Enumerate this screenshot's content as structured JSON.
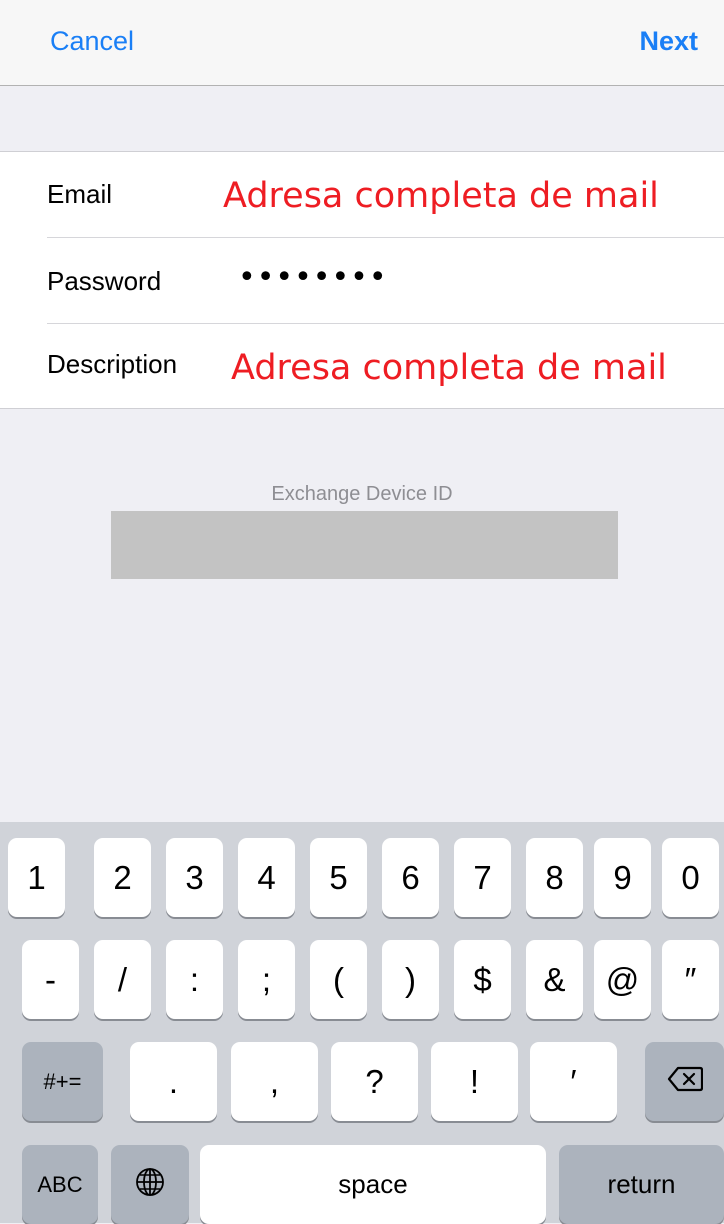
{
  "navbar": {
    "cancel_label": "Cancel",
    "next_label": "Next"
  },
  "form": {
    "rows": [
      {
        "label": "Email",
        "value": "Adresa completa de mail"
      },
      {
        "label": "Password",
        "value": "••••••••"
      },
      {
        "label": "Description",
        "value": "Adresa completa de mail"
      }
    ]
  },
  "device": {
    "caption": "Exchange Device ID"
  },
  "keyboard": {
    "row1": [
      "1",
      "2",
      "3",
      "4",
      "5",
      "6",
      "7",
      "8",
      "9",
      "0"
    ],
    "row2": [
      "-",
      "/",
      ":",
      ";",
      "(",
      ")",
      "$",
      "&",
      "@",
      "″"
    ],
    "row3": {
      "mode": "#+=",
      "keys": [
        ".",
        ",",
        "?",
        "!",
        "′"
      ],
      "delete_icon": "backspace-icon"
    },
    "row4": {
      "abc": "ABC",
      "globe_icon": "globe-icon",
      "space": "space",
      "return": "return"
    }
  },
  "colors": {
    "accent": "#1a7ff6",
    "annotation": "#ee1d23",
    "keyboard_bg": "#d0d3d9"
  }
}
